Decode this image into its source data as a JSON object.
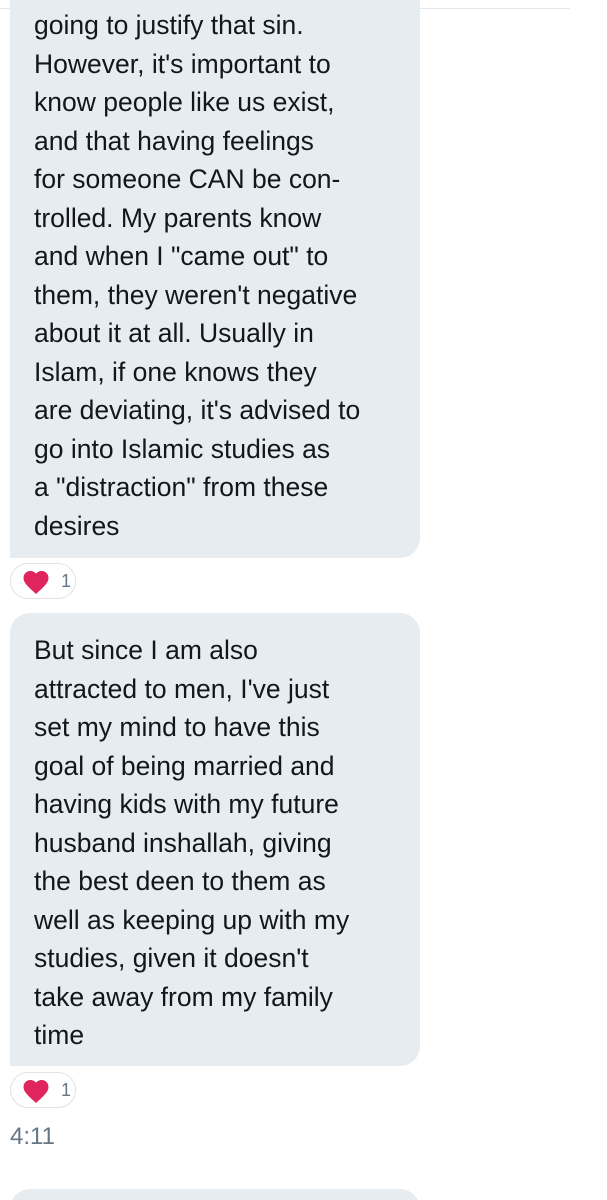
{
  "messages": [
    {
      "lines": [
        "going to justify that sin.",
        "However, it's important to",
        "know people like us exist,",
        "and that having feelings",
        "for someone CAN be con-",
        "trolled. My parents know",
        "and when I \"came out\" to",
        "them, they weren't negative",
        "about it at all. Usually in",
        "Islam, if one knows they",
        "are deviating, it's advised to",
        "go into Islamic studies as",
        "a \"distraction\" from these",
        "desires"
      ],
      "reaction": {
        "icon": "heart-icon",
        "count": "1"
      }
    },
    {
      "lines": [
        "But since I am also",
        "attracted to men, I've just",
        "set my mind to have this",
        "goal of being married and",
        "having kids with my future",
        "husband inshallah, giving",
        "the best deen to them as",
        "well as keeping up with my",
        "studies, given it doesn't",
        "take away from my family",
        "time"
      ],
      "reaction": {
        "icon": "heart-icon",
        "count": "1"
      },
      "timestamp": "4:11"
    }
  ],
  "colors": {
    "bubble_background": "#e6ecf0",
    "text": "#14171a",
    "heart": "#e0245e",
    "muted": "#657786"
  }
}
